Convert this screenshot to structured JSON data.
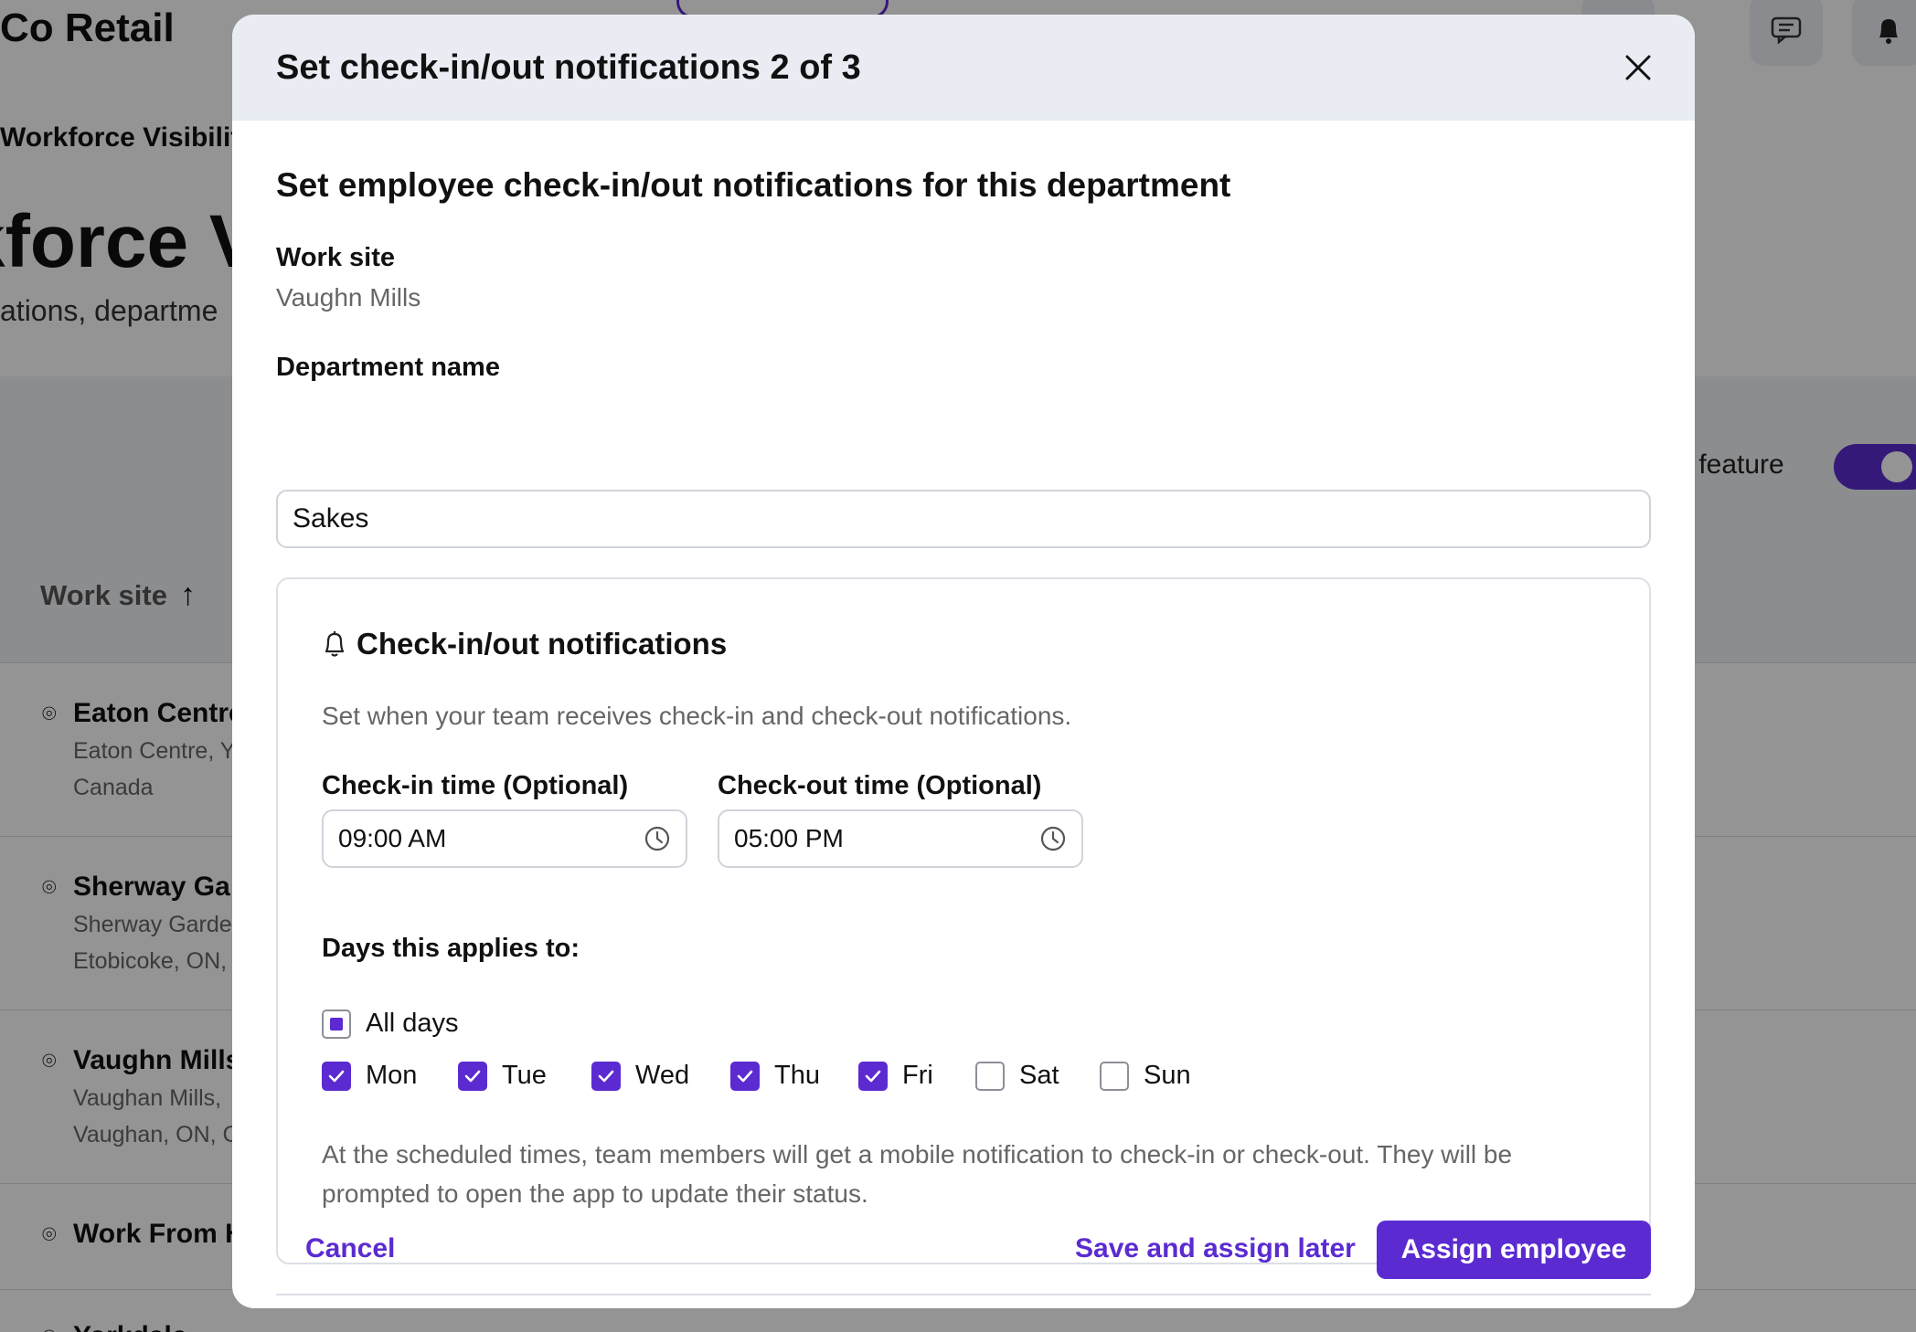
{
  "background": {
    "brand": "Co Retail",
    "breadcrumb": "Workforce Visibilit",
    "heading": "kforce Vi",
    "subheading": "ations, departme",
    "feature_label": "s feature",
    "table_header": "Work site",
    "rows": [
      {
        "title": "Eaton Centre",
        "line1": "Eaton Centre, Y",
        "line2": "Canada"
      },
      {
        "title": "Sherway Ga",
        "line1": "Sherway Garde",
        "line2": "Etobicoke, ON,"
      },
      {
        "title": "Vaughn Mills",
        "line1": "Vaughan Mills,",
        "line2": "Vaughan, ON, C"
      },
      {
        "title": "Work From H",
        "line1": "",
        "line2": ""
      },
      {
        "title": "Yorkdale",
        "line1": "",
        "line2": ""
      }
    ]
  },
  "modal": {
    "title": "Set check-in/out notifications 2 of 3",
    "subtitle": "Set employee check-in/out notifications for this department",
    "work_site_label": "Work site",
    "work_site_value": "Vaughn Mills",
    "department_label": "Department name",
    "department_value": "Sakes",
    "card": {
      "title": "Check-in/out notifications",
      "description": "Set when your team receives check-in and check-out notifications.",
      "checkin_label": "Check-in time (Optional)",
      "checkin_value": "09:00 AM",
      "checkout_label": "Check-out time (Optional)",
      "checkout_value": "05:00 PM",
      "days_label": "Days this applies to:",
      "all_days_label": "All days",
      "days": [
        {
          "label": "Mon",
          "checked": true
        },
        {
          "label": "Tue",
          "checked": true
        },
        {
          "label": "Wed",
          "checked": true
        },
        {
          "label": "Thu",
          "checked": true
        },
        {
          "label": "Fri",
          "checked": true
        },
        {
          "label": "Sat",
          "checked": false
        },
        {
          "label": "Sun",
          "checked": false
        }
      ],
      "note": "At the scheduled times, team members will get a mobile notification to check-in or check-out. They will be prompted to open the app to update their status."
    },
    "footer": {
      "cancel": "Cancel",
      "save_later": "Save and assign later",
      "assign": "Assign employee"
    }
  },
  "colors": {
    "accent": "#5b2bd1",
    "header_bg": "#e9edf3",
    "muted_text": "#666666"
  },
  "icons": [
    "close-icon",
    "bell-icon",
    "clock-icon",
    "check-icon",
    "map-pin-icon",
    "arrow-up-icon",
    "chat-icon"
  ]
}
